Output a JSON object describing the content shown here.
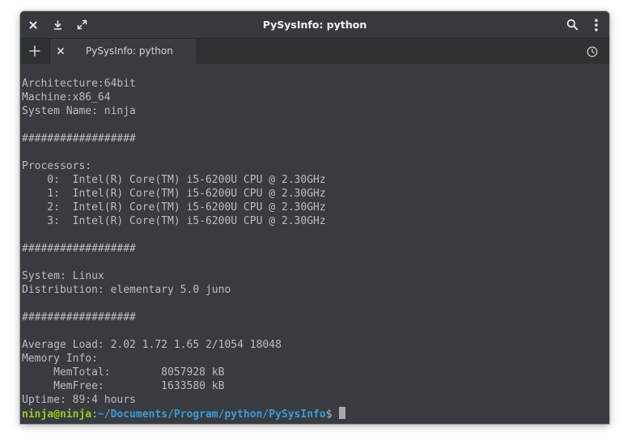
{
  "window": {
    "title": "PySysInfo: python"
  },
  "titlebar": {
    "close_icon": "close-icon",
    "download_icon": "download-icon",
    "maximize_icon": "maximize-icon",
    "search_icon": "search-icon",
    "menu_icon": "menu-icon"
  },
  "tabs": [
    {
      "label": "PySysInfo: python"
    }
  ],
  "terminal": {
    "output": "Architecture:64bit\nMachine:x86_64\nSystem Name: ninja\n\n##################\n\nProcessors:\n    0:  Intel(R) Core(TM) i5-6200U CPU @ 2.30GHz\n    1:  Intel(R) Core(TM) i5-6200U CPU @ 2.30GHz\n    2:  Intel(R) Core(TM) i5-6200U CPU @ 2.30GHz\n    3:  Intel(R) Core(TM) i5-6200U CPU @ 2.30GHz\n\n##################\n\nSystem: Linux\nDistribution: elementary 5.0 juno\n\n##################\n\nAverage Load: 2.02 1.72 1.65 2/1054 18048\nMemory Info:\n     MemTotal:        8057928 kB\n     MemFree:         1633580 kB\nUptime: 89:4 hours",
    "prompt": {
      "user_host": "ninja@ninja",
      "separator": ":",
      "path": "~/Documents/Program/python/PySysInfo",
      "symbol": "$"
    }
  },
  "colors": {
    "window_bg": "#383c40",
    "tabbar_bg": "#2f3235",
    "text": "#bcbcbc",
    "prompt_user": "#99c826",
    "prompt_path": "#3e9ad8",
    "cursor": "#a8a8a8"
  }
}
